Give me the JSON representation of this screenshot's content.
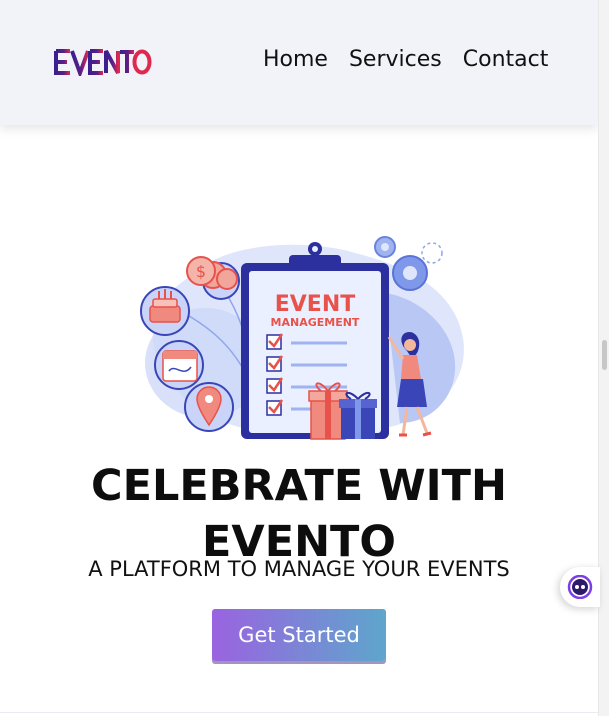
{
  "header": {
    "logo_text": "EVENTO",
    "nav": [
      {
        "label": "Home"
      },
      {
        "label": "Services"
      },
      {
        "label": "Contact"
      }
    ]
  },
  "hero": {
    "illustration": {
      "clipboard_heading": "EVENT",
      "clipboard_subheading": "MANAGEMENT",
      "checklist_items": 4,
      "coin_symbol": "$"
    },
    "title": "CELEBRATE WITH EVENTO",
    "subtitle": "A PLATFORM TO MANAGE YOUR EVENTS",
    "cta_label": "Get Started"
  },
  "chat_widget": {
    "icon": "chat-bot-icon"
  },
  "colors": {
    "navbar_bg": "#f1f3f8",
    "logo_purple": "#3b1f8f",
    "logo_red": "#e0284f",
    "cta_gradient_start": "#9a63e0",
    "cta_gradient_end": "#5ea6cc",
    "illustration_blue": "#2c2f9e",
    "illustration_red": "#e8524a"
  }
}
